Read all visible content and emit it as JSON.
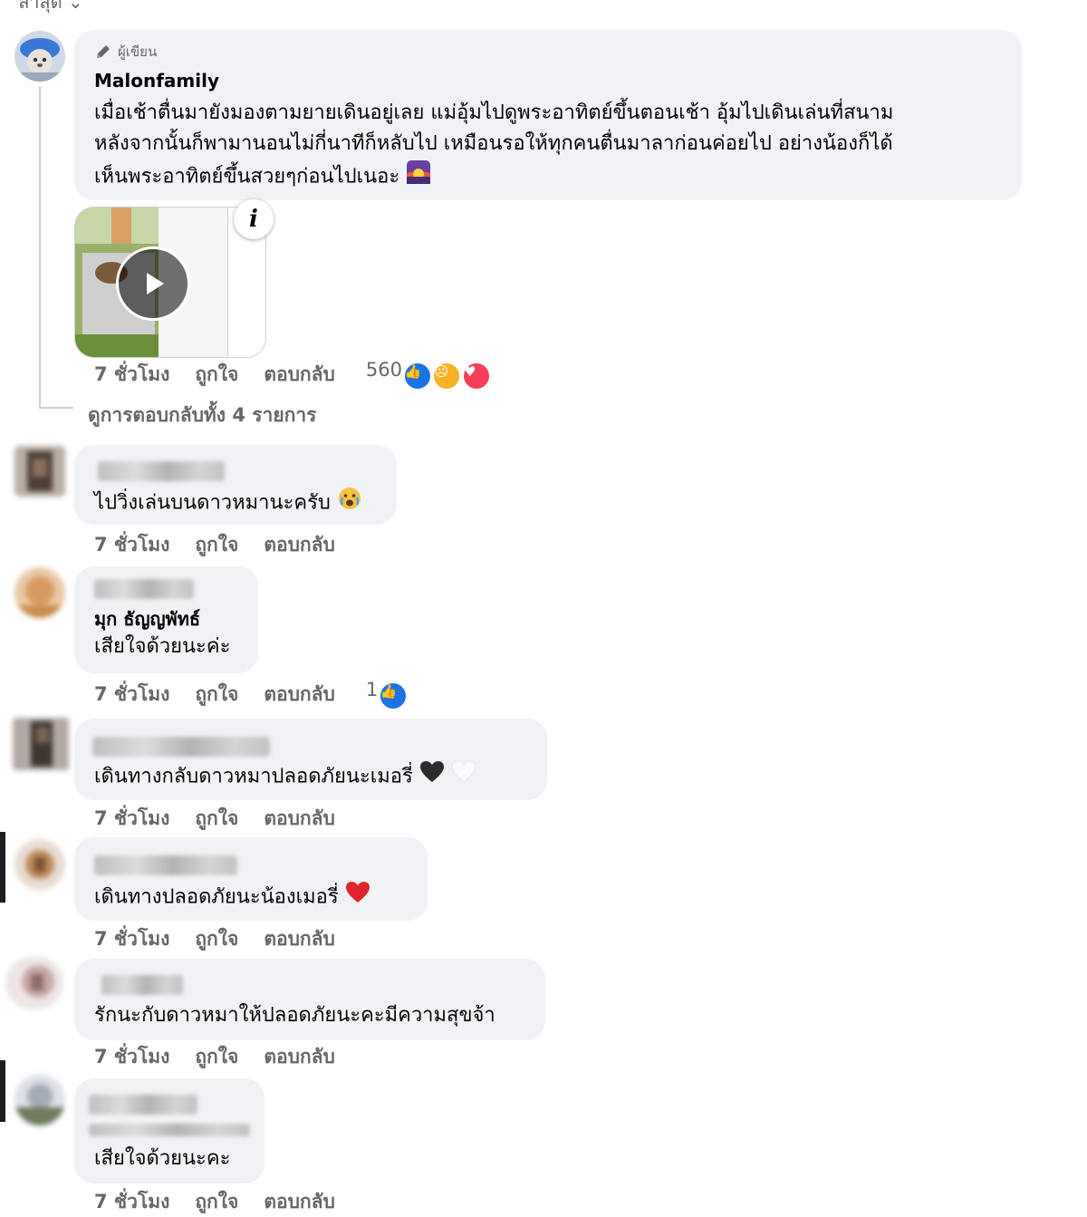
{
  "top_partial_text": "ล่าสุด",
  "comments": [
    {
      "author_badge": "ผู้เขียน",
      "name": "Malonfamily",
      "lines": [
        "เมื่อเช้าตื่นมายังมองตามยายเดินอยู่เลย แม่อุ้มไปดูพระอาทิตย์ขึ้นตอนเช้า อุ้มไปเดินเล่นที่สนาม",
        "หลังจากนั้นก็พามานอนไม่กี่นาทีก็หลับไป เหมือนรอให้ทุกคนตื่นมาลาก่อนค่อยไป อย่างน้องก็ได้",
        "เห็นพระอาทิตย์ขึ้นสวยๆก่อนไปเนอะ"
      ],
      "time": "7 ชั่วโมง",
      "like": "ถูกใจ",
      "reply": "ตอบกลับ",
      "reaction_count": "560",
      "info_glyph": "i"
    },
    {
      "text": "ไปวิ่งเล่นบนดาวหมานะครับ",
      "time": "7 ชั่วโมง",
      "like": "ถูกใจ",
      "reply": "ตอบกลับ"
    },
    {
      "name": "มุก ธัญญพัทธ์",
      "text": "เสียใจด้วยนะค่ะ",
      "time": "7 ชั่วโมง",
      "like": "ถูกใจ",
      "reply": "ตอบกลับ",
      "reaction_count": "1"
    },
    {
      "text": "เดินทางกลับดาวหมาปลอดภัยนะเมอรี่",
      "time": "7 ชั่วโมง",
      "like": "ถูกใจ",
      "reply": "ตอบกลับ"
    },
    {
      "text": "เดินทางปลอดภัยนะน้องเมอรี่",
      "time": "7 ชั่วโมง",
      "like": "ถูกใจ",
      "reply": "ตอบกลับ"
    },
    {
      "text": "รักนะกับดาวหมาให้ปลอดภัยนะคะมีความสุขจ้า",
      "time": "7 ชั่วโมง",
      "like": "ถูกใจ",
      "reply": "ตอบกลับ"
    },
    {
      "text": "เสียใจด้วยนะคะ",
      "time": "7 ชั่วโมง",
      "like": "ถูกใจ",
      "reply": "ตอบกลับ"
    }
  ],
  "see_replies": "ดูการตอบกลับทั้ง 4 รายการ",
  "colors": {
    "bubble": "#f0f2f5",
    "meta": "#65676b",
    "like_blue": "#1b74e4",
    "love_red": "#f33e58",
    "sad_yellow": "#f7b125"
  },
  "icons": [
    "pencil-icon",
    "play-icon",
    "info-icon",
    "like-reaction-icon",
    "sad-reaction-icon",
    "love-reaction-icon",
    "sunrise-emoji-icon",
    "crying-emoji-icon",
    "black-heart-icon",
    "white-heart-icon",
    "red-heart-icon"
  ]
}
